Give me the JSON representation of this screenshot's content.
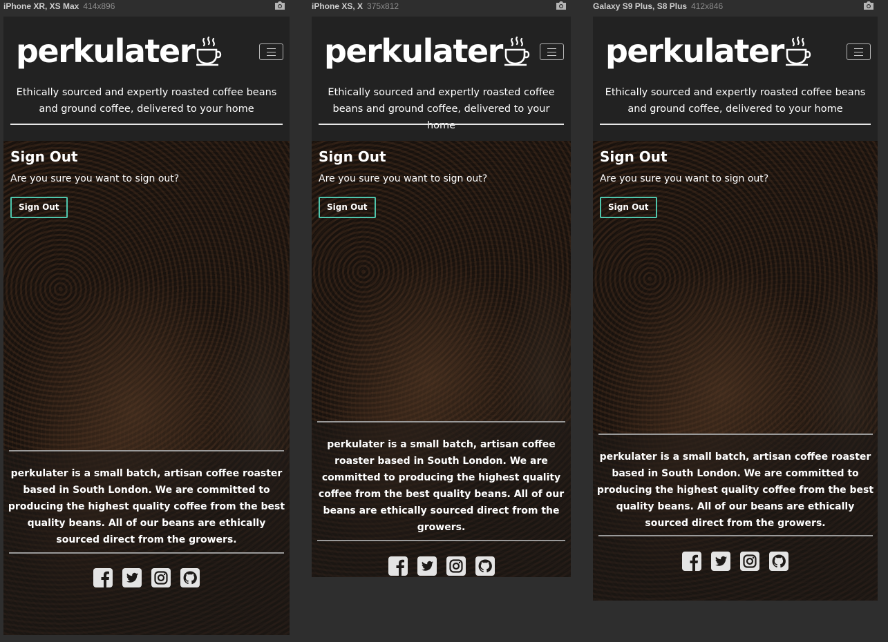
{
  "devices": [
    {
      "name": "iPhone XR, XS Max",
      "dims": "414x896"
    },
    {
      "name": "iPhone XS, X",
      "dims": "375x812"
    },
    {
      "name": "Galaxy S9 Plus, S8 Plus",
      "dims": "412x846"
    }
  ],
  "site": {
    "logo": "perkulater",
    "tagline": "Ethically sourced and expertly roasted coffee beans and ground coffee, delivered to your home"
  },
  "signout": {
    "heading": "Sign Out",
    "question": "Are you sure you want to sign out?",
    "button": "Sign Out"
  },
  "footer": {
    "about": "perkulater is a small batch, artisan coffee roaster based in South London. We are committed to producing the highest quality coffee from the best quality beans. All of our beans are ethically sourced direct from the growers.",
    "socials": [
      "facebook-icon",
      "twitter-icon",
      "instagram-icon",
      "github-icon"
    ]
  },
  "colors": {
    "accent": "#4fc6ad",
    "page_bg": "#2e2e2e",
    "header_bg": "#222222"
  }
}
